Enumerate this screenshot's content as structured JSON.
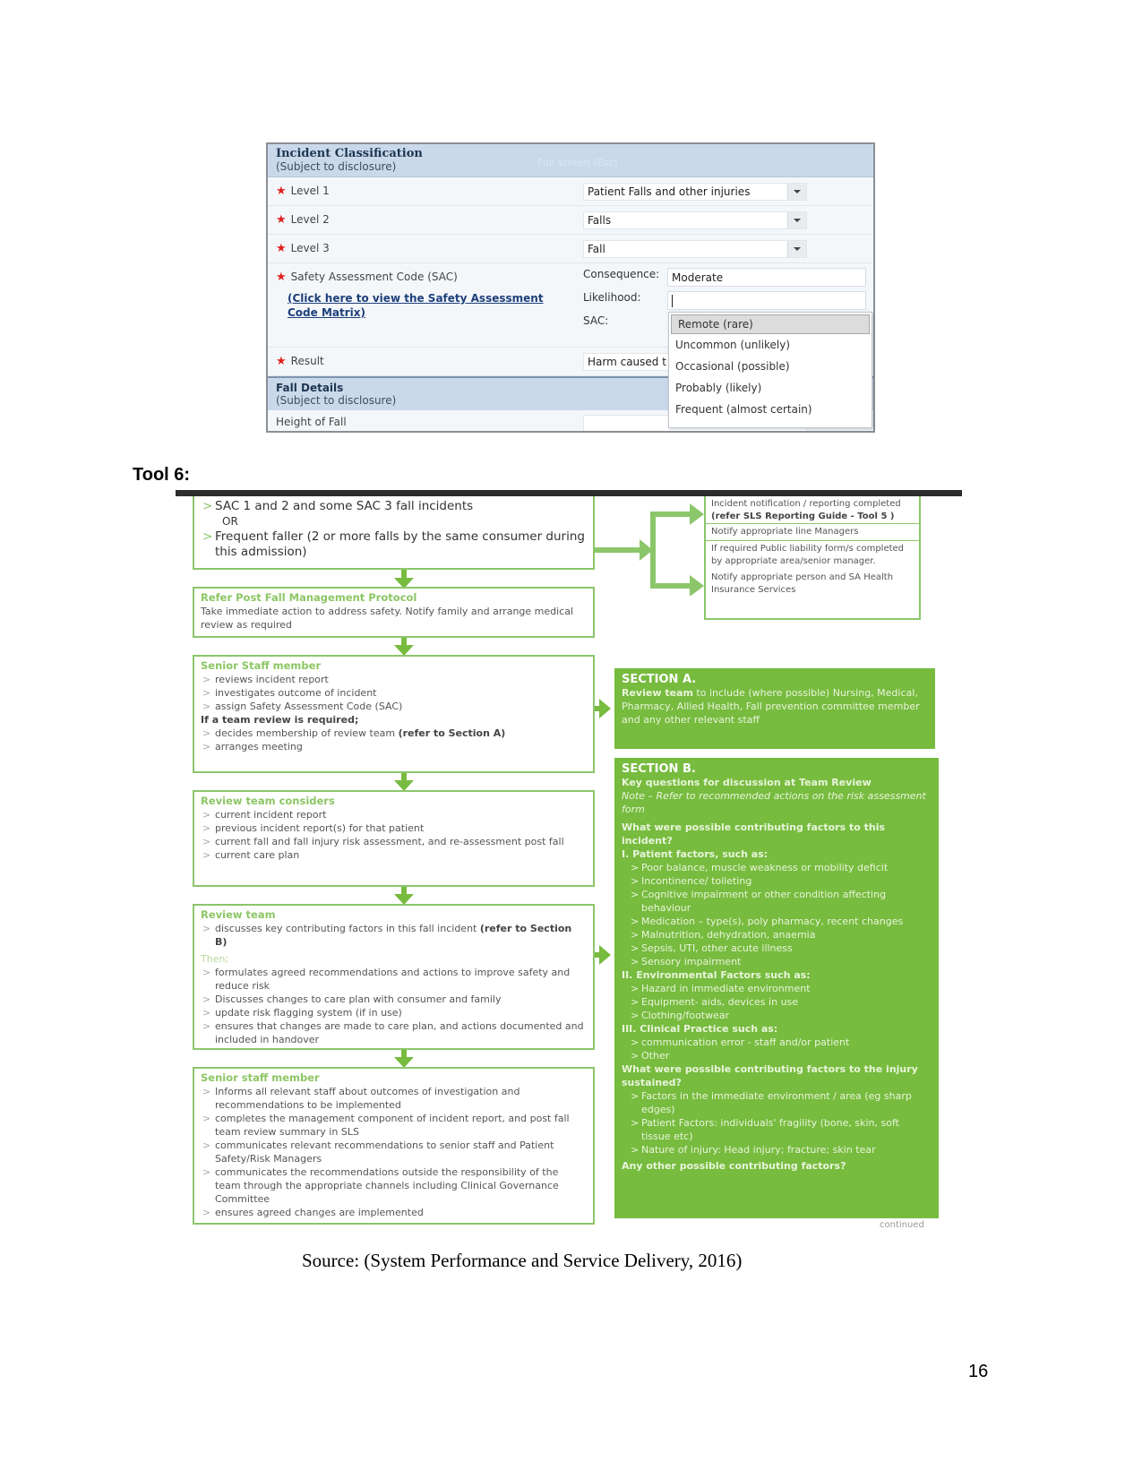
{
  "form": {
    "header_title": "Incident Classification",
    "header_subtitle": "(Subject to disclosure)",
    "header_faint": "Full screen (Esc)",
    "required_marker": "★",
    "rows": [
      {
        "label": "Level 1",
        "value": "Patient Falls and other injuries"
      },
      {
        "label": "Level 2",
        "value": "Falls"
      },
      {
        "label": "Level 3",
        "value": "Fall"
      }
    ],
    "sac": {
      "label": "Safety Assessment Code (SAC)",
      "link": "(Click here to view the Safety Assessment Code Matrix)",
      "consequence_label": "Consequence:",
      "consequence_value": "Moderate",
      "likelihood_label": "Likelihood:",
      "likelihood_value": "",
      "sac_label": "SAC:"
    },
    "result": {
      "label": "Result",
      "value": "Harm caused t"
    },
    "likelihood_options": [
      "Remote (rare)",
      "Uncommon (unlikely)",
      "Occasional (possible)",
      "Probably (likely)",
      "Frequent (almost certain)"
    ],
    "fall_section_title": "Fall Details",
    "fall_section_subtitle": "(Subject to disclosure)",
    "height_label": "Height of Fall"
  },
  "tool_heading": "Tool 6:",
  "flow": {
    "start": {
      "items": [
        "SAC 1 and 2 and some SAC 3 fall incidents",
        "Frequent faller (2 or more falls by the same consumer during this admission)"
      ],
      "or": "OR"
    },
    "right_top": {
      "cell1_line1": "Incident notification / reporting completed",
      "cell1_line2": "(refer SLS Reporting Guide - Tool 5 )",
      "cell2": "Notify appropriate line Managers",
      "cell3": "If required Public liability form/s completed by appropriate area/senior manager.",
      "cell4": "Notify appropriate person and SA Health Insurance Services"
    },
    "protocol": {
      "title": "Refer Post Fall Management Protocol",
      "text": "Take immediate action to address safety. Notify family and arrange medical review as required"
    },
    "senior1": {
      "title": "Senior Staff member",
      "items": [
        "reviews incident report",
        "investigates outcome of incident",
        "assign Safety Assessment Code (SAC)"
      ],
      "condition": "If a team review is required;",
      "items2_0_text": "decides membership of review  team ",
      "items2_0_bold": "(refer to Section A)",
      "items2_1": "arranges meeting"
    },
    "considers": {
      "title": "Review team considers",
      "items": [
        "current incident report",
        "previous incident report(s) for that patient",
        "current fall and fall injury risk assessment, and re-assessment post fall",
        "current care plan"
      ]
    },
    "review": {
      "title": "Review team",
      "first_text": " discusses key contributing factors in this fall incident ",
      "first_bold": "(refer to Section B)",
      "then": "Then;",
      "items": [
        "formulates agreed recommendations and actions to improve safety and reduce risk",
        "Discusses changes to care plan with consumer and family",
        "update risk flagging system (if in use)",
        "ensures that changes are made to care plan, and actions documented and included in handover"
      ]
    },
    "senior2": {
      "title": "Senior staff member",
      "items": [
        "Informs all relevant staff about outcomes of investigation and recommendations to be implemented",
        "completes the management component of incident report, and post fall team review summary in SLS",
        "communicates relevant recommendations to senior staff and Patient Safety/Risk Managers",
        "communicates the recommendations outside the responsibility of the team through the appropriate channels including Clinical Governance Committee",
        "ensures agreed changes are implemented"
      ]
    },
    "section_a": {
      "title": "SECTION A.",
      "bold": "Review team",
      "text": " to include (where possible) Nursing, Medical, Pharmacy, Allied Health, Fall prevention committee member and any other relevant staff"
    },
    "section_b": {
      "title": "SECTION B.",
      "subtitle": "Key questions for discussion at Team Review",
      "note": "Note – Refer to recommended actions on the risk assessment form",
      "q1": "What were possible contributing factors to this incident?",
      "g1": "I. Patient factors, such as:",
      "g1_items": [
        "Poor balance, muscle weakness or mobility deficit",
        "Incontinence/ toileting",
        "Cognitive impairment or other condition affecting behaviour",
        "Medication – type(s), poly pharmacy, recent changes",
        "Malnutrition, dehydration, anaemia",
        "Sepsis, UTI, other acute illness",
        "Sensory impairment"
      ],
      "g2": "II. Environmental Factors such as:",
      "g2_items": [
        "Hazard in immediate environment",
        "Equipment- aids, devices in use",
        "Clothing/footwear"
      ],
      "g3": "III. Clinical Practice such as:",
      "g3_items": [
        "communication error -  staff and/or patient",
        " Other"
      ],
      "q2": "What were possible contributing factors to the injury sustained?",
      "q2_items": [
        "Factors in the immediate environment / area (eg sharp edges)",
        "Patient Factors: individuals' fragility (bone, skin, soft tissue etc)",
        "Nature of injury: Head injury; fracture; skin tear"
      ],
      "q3": "Any other possible contributing factors?"
    },
    "continued": "continued"
  },
  "source": "Source: (System Performance and Service Delivery, 2016)",
  "page_number": "16",
  "colors": {
    "flow_green": "#77bb3f",
    "border_green": "#8cc66b",
    "form_header": "#c9d9ea",
    "required_red": "#e0201f"
  }
}
